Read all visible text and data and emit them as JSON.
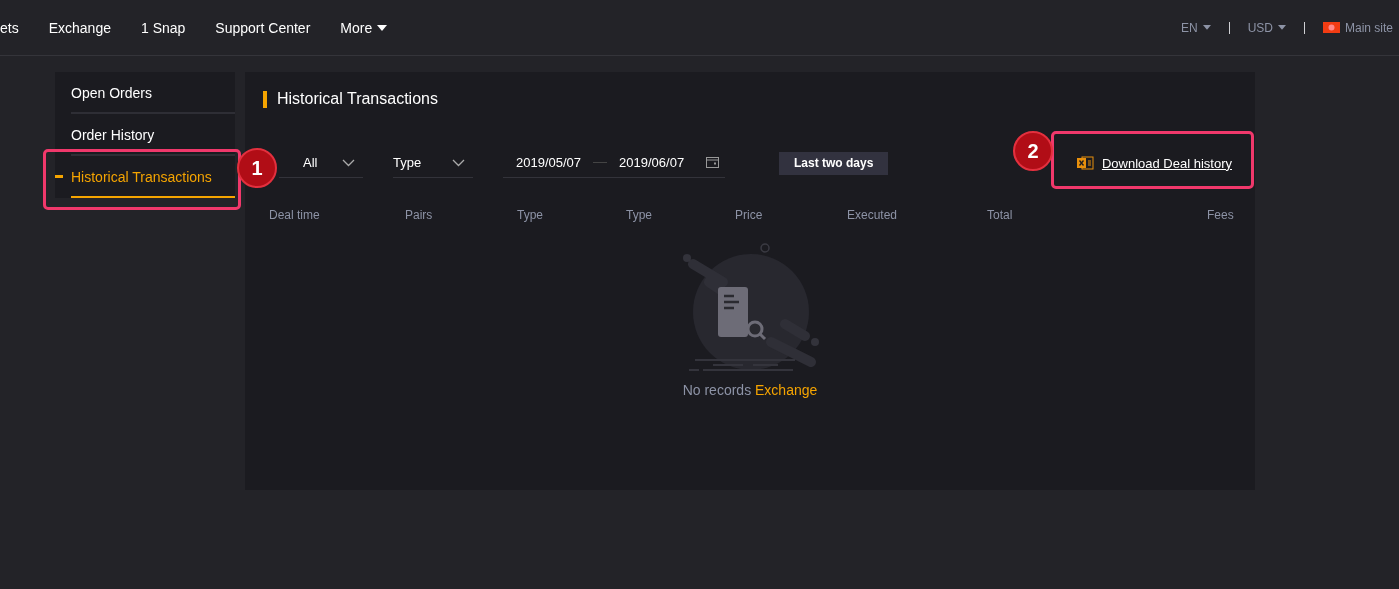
{
  "nav": {
    "items": [
      "ets",
      "Exchange",
      "1 Snap",
      "Support Center"
    ],
    "more": "More",
    "language": "EN",
    "currency": "USD",
    "main_site": "Main site"
  },
  "sidebar": {
    "items": [
      {
        "label": "Open Orders",
        "selected": false
      },
      {
        "label": "Order History",
        "selected": false
      },
      {
        "label": "Historical Transactions",
        "selected": true
      }
    ]
  },
  "panel": {
    "title": "Historical Transactions",
    "filters": [
      {
        "value": "All"
      },
      {
        "value": "Type"
      }
    ],
    "date_from": "2019/05/07",
    "date_to": "2019/06/07",
    "quick_range": "Last two days",
    "download": "Download Deal history",
    "columns": [
      "Deal time",
      "Pairs",
      "Type",
      "Type",
      "Price",
      "Executed",
      "Total",
      "Fees"
    ],
    "empty": {
      "text": "No records",
      "link": "Exchange"
    }
  },
  "annotations": [
    "1",
    "2"
  ]
}
